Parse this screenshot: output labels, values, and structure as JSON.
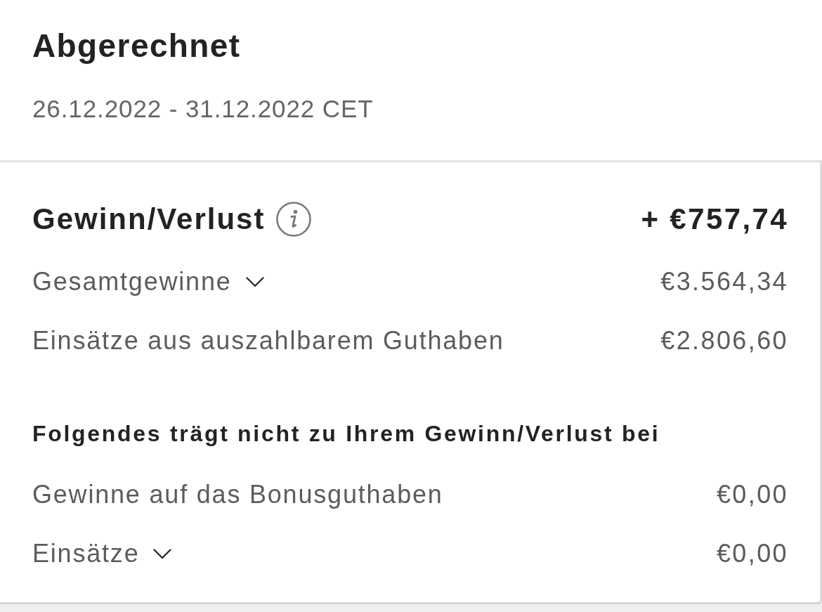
{
  "header": {
    "title": "Abgerechnet",
    "period": "26.12.2022 - 31.12.2022 CET"
  },
  "summary": {
    "title": "Gewinn/Verlust",
    "total": "+ €757,74",
    "rows": [
      {
        "kind": "expandable",
        "label": "Gesamtgewinne",
        "value": "€3.564,34"
      },
      {
        "kind": "plain",
        "label": "Einsätze aus auszahlbarem Guthaben",
        "value": "€2.806,60"
      }
    ]
  },
  "excluded": {
    "title": "Folgendes trägt nicht zu Ihrem Gewinn/Verlust bei",
    "rows": [
      {
        "kind": "plain",
        "label": "Gewinne auf das Bonusguthaben",
        "value": "€0,00"
      },
      {
        "kind": "expandable",
        "label": "Einsätze",
        "value": "€0,00"
      }
    ]
  }
}
